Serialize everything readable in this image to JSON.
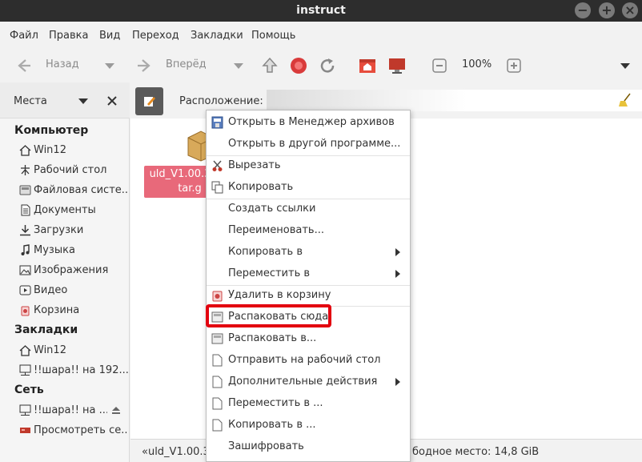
{
  "window": {
    "title": "instruct",
    "buttons": [
      "−",
      "+",
      "×"
    ]
  },
  "menubar": [
    "Файл",
    "Правка",
    "Вид",
    "Переход",
    "Закладки",
    "Помощь"
  ],
  "toolbar": {
    "back": "Назад",
    "forward": "Вперёд",
    "zoom": "100%"
  },
  "location": {
    "label": "Расположение:",
    "value": ""
  },
  "sidebar": {
    "title": "Места",
    "sections": [
      {
        "heading": "Компьютер",
        "items": [
          {
            "label": "Win12",
            "icon": "home-icon"
          },
          {
            "label": "Рабочий стол",
            "icon": "desktop-icon"
          },
          {
            "label": "Файловая систе...",
            "icon": "drive-icon"
          },
          {
            "label": "Документы",
            "icon": "document-icon"
          },
          {
            "label": "Загрузки",
            "icon": "download-icon"
          },
          {
            "label": "Музыка",
            "icon": "music-icon"
          },
          {
            "label": "Изображения",
            "icon": "image-icon"
          },
          {
            "label": "Видео",
            "icon": "video-icon"
          },
          {
            "label": "Корзина",
            "icon": "trash-icon"
          }
        ]
      },
      {
        "heading": "Закладки",
        "items": [
          {
            "label": "Win12",
            "icon": "home-icon"
          },
          {
            "label": "!!шара!! на 192....",
            "icon": "network-drive-icon"
          }
        ]
      },
      {
        "heading": "Сеть",
        "items": [
          {
            "label": "!!шара!! на ...",
            "icon": "network-drive-icon"
          },
          {
            "label": "Просмотреть се...",
            "icon": "network-icon"
          }
        ]
      }
    ]
  },
  "file": {
    "name_line1": "uld_V1.00.3",
    "name_line2": "tar.g"
  },
  "status": {
    "selection": "«uld_V1.00.3",
    "free_space": "бодное место: 14,8 GiB"
  },
  "context_menu": [
    {
      "label": "Открыть в Менеджер архивов",
      "icon": "archive-manager-icon",
      "submenu": false
    },
    {
      "label": "Открыть в другой программе...",
      "icon": "",
      "submenu": false
    },
    {
      "separator": true
    },
    {
      "label": "Вырезать",
      "icon": "scissors-icon",
      "submenu": false
    },
    {
      "label": "Копировать",
      "icon": "copy-icon",
      "submenu": false
    },
    {
      "separator": true
    },
    {
      "label": "Создать ссылки",
      "icon": "",
      "submenu": false
    },
    {
      "label": "Переименовать...",
      "icon": "",
      "submenu": false
    },
    {
      "label": "Копировать в",
      "icon": "",
      "submenu": true
    },
    {
      "label": "Переместить в",
      "icon": "",
      "submenu": true
    },
    {
      "separator": true
    },
    {
      "label": "Удалить в корзину",
      "icon": "trash-icon",
      "submenu": false
    },
    {
      "separator": true
    },
    {
      "label": "Распаковать сюда",
      "icon": "extract-icon",
      "submenu": false
    },
    {
      "label": "Распаковать в...",
      "icon": "extract-icon",
      "submenu": false
    },
    {
      "label": "Отправить на рабочий стол",
      "icon": "document-icon",
      "submenu": false
    },
    {
      "label": "Дополнительные действия",
      "icon": "document-icon",
      "submenu": true
    },
    {
      "label": "Переместить в ...",
      "icon": "document-icon",
      "submenu": false
    },
    {
      "label": "Копировать в ...",
      "icon": "document-icon",
      "submenu": false
    },
    {
      "label": "Зашифровать",
      "icon": "",
      "submenu": false
    }
  ],
  "colors": {
    "titlebar": "#2d2d2d",
    "selection": "#e8697a",
    "highlight_box": "#e3000f"
  }
}
